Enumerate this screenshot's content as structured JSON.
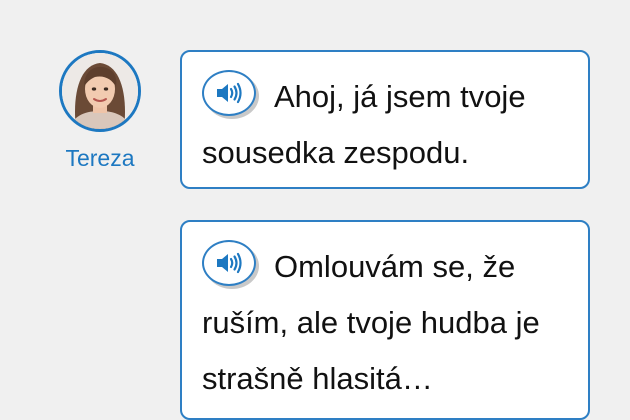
{
  "speaker": {
    "name": "Tereza",
    "avatar_icon": "woman-portrait"
  },
  "accent_color": "#1d78c1",
  "messages": [
    {
      "text": "Ahoj, já jsem tvoje sousedka zespodu.",
      "audio_icon": "speaker-icon"
    },
    {
      "text": "Omlouvám se, že ruším, ale tvoje hudba je strašně hlasitá…",
      "audio_icon": "speaker-icon"
    }
  ]
}
